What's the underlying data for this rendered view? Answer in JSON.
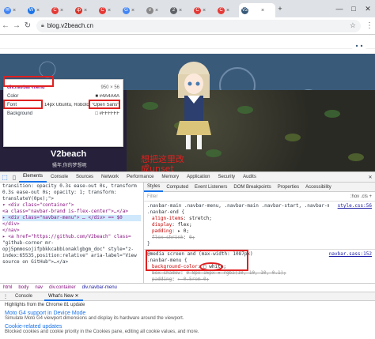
{
  "browser": {
    "tabs": [
      {
        "label": "✉",
        "color": "#4285f4"
      },
      {
        "label": "W",
        "color": "#1a73e8"
      },
      {
        "label": "C",
        "color": "#e53935"
      },
      {
        "label": "ф",
        "color": "#d93025"
      },
      {
        "label": "C",
        "color": "#e53935"
      },
      {
        "label": "G",
        "color": "#4285f4"
      },
      {
        "label": "v",
        "color": "#888888"
      },
      {
        "label": "2",
        "color": "#5f6368"
      },
      {
        "label": "C",
        "color": "#e53935"
      },
      {
        "label": "C",
        "color": "#e53935"
      },
      {
        "label": "V2",
        "color": "#3a5a7a",
        "active": true
      }
    ],
    "new_tab": "+",
    "minimize": "—",
    "maximize": "□",
    "close": "✕",
    "url": "blog.v2beach.cn",
    "back": "←",
    "forward": "→",
    "reload": "↻",
    "star": "☆",
    "menu": "⋮"
  },
  "site": {
    "profile_name": "V2beach",
    "profile_subtitle": "骚年,你的梦想呢",
    "annotation": "想把这里改成unset"
  },
  "tooltip": {
    "selector": "div.navbar-menu",
    "size": "950 × 56",
    "rows": [
      {
        "label": "Color",
        "value": "■ #4A4A4A"
      },
      {
        "label": "Font",
        "value": "14px Ubuntu, Roboto, \"Open Sans\", \"Micr"
      },
      {
        "label": "Background",
        "value": "□ #FFFFFF"
      }
    ]
  },
  "devtools": {
    "tabs": [
      "Elements",
      "Console",
      "Sources",
      "Network",
      "Performance",
      "Memory",
      "Application",
      "Security",
      "Audits"
    ],
    "close": "✕",
    "elements_lines": [
      "transition: opacity 0.3s ease-out 0s, transform",
      "0.3s ease-out 0s; opacity: 1; transform:",
      "translateY(0px);\">",
      "▾ <div class=\"container\">",
      "  <a class=\"navbar-brand is-flex-center\">…</a>",
      "  ▸ <div class=\"navbar-menu\"> … </div> == $0",
      "  </div>",
      "</nav>",
      "▸ <a href=\"https://github.com/V2beach\" class=",
      "\"github-corner mr-",
      "opj5pmmosojifpbkkcabbionaklgbgm_doc\" style=\"z-",
      "index:65535,position:relative\" aria-label=\"View",
      "source on GitHub\">…</a>"
    ],
    "styles_tabs": [
      "Styles",
      "Computed",
      "Event Listeners",
      "DOM Breakpoints",
      "Properties",
      "Accessibility"
    ],
    "filter_placeholder": "Filter",
    "filter_hov": ":hov  .cls  +",
    "rule1_selector": ".navbar-main .navbar-menu, .navbar-main .navbar-start, .navbar-main",
    "rule1_selector2": ".navbar-end {",
    "rule1_source": "style.css:56",
    "rule1_props": [
      {
        "p": "align-items",
        "v": "stretch;",
        "strike": false
      },
      {
        "p": "display",
        "v": "flex;",
        "strike": false
      },
      {
        "p": "padding",
        "v": "▸ 0;",
        "strike": false
      },
      {
        "p": "flex-shrink",
        "v": "0;",
        "strike": true
      }
    ],
    "rule2_media": "@media screen and (max-width: 1087px)",
    "rule2_selector": ".navbar-menu {",
    "rule2_source": "navbar.sass:152",
    "rule2_props": [
      {
        "p": "background-color",
        "v": "□ white;",
        "strike": false
      },
      {
        "p": "box-shadow",
        "v": "0 8px 16px ▪ rgba(10, 10, 10, 0.1);",
        "strike": true
      },
      {
        "p": "padding",
        "v": "▸ 0.5rem 0;",
        "strike": true
      }
    ],
    "breadcrumbs": [
      "html",
      "body",
      "nav",
      "div.container",
      "div.navbar-menu"
    ],
    "drawer_tabs": [
      "Console",
      "What's New ✕"
    ],
    "whatsnew_header": "Highlights from the Chrome 81 update",
    "whatsnew_items": [
      {
        "title": "Moto G4 support in Device Mode",
        "desc": "Simulate Moto G4 viewport dimensions and display its hardware around the viewport."
      },
      {
        "title": "Cookie-related updates",
        "desc": "Blocked cookies and cookie priority in the Cookies pane, editing all cookie values, and more."
      }
    ]
  }
}
